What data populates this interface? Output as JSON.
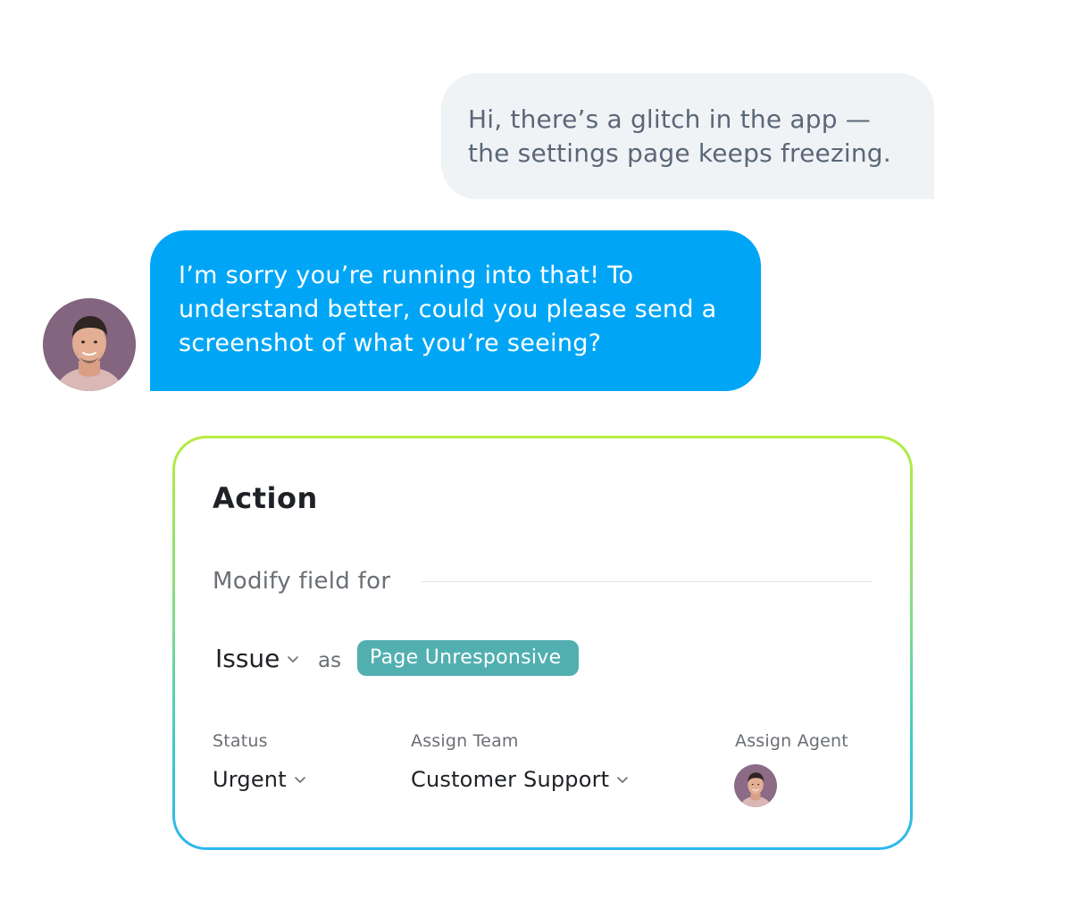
{
  "chat": {
    "user_message": "Hi, there’s a glitch in the app — the settings page keeps freezing.",
    "agent_message": "I’m sorry you’re running into that! To understand better, could you please send a screenshot of what you’re seeing?",
    "agent_bubble_color": "#00a6f5",
    "user_bubble_color": "#f0f3f6"
  },
  "action": {
    "title": "Action",
    "modify_label": "Modify field for",
    "field_name": "Issue",
    "as_label": "as",
    "field_value": "Page Unresponsive",
    "pill_color": "#52afb0",
    "status": {
      "label": "Status",
      "value": "Urgent"
    },
    "team": {
      "label": "Assign Team",
      "value": "Customer Support"
    },
    "agent": {
      "label": "Assign Agent",
      "avatar_icon": "agent-avatar-icon"
    },
    "border_gradient": [
      "#b6ec3f",
      "#7edc8a",
      "#3fc9c8",
      "#2cb6f0"
    ]
  }
}
